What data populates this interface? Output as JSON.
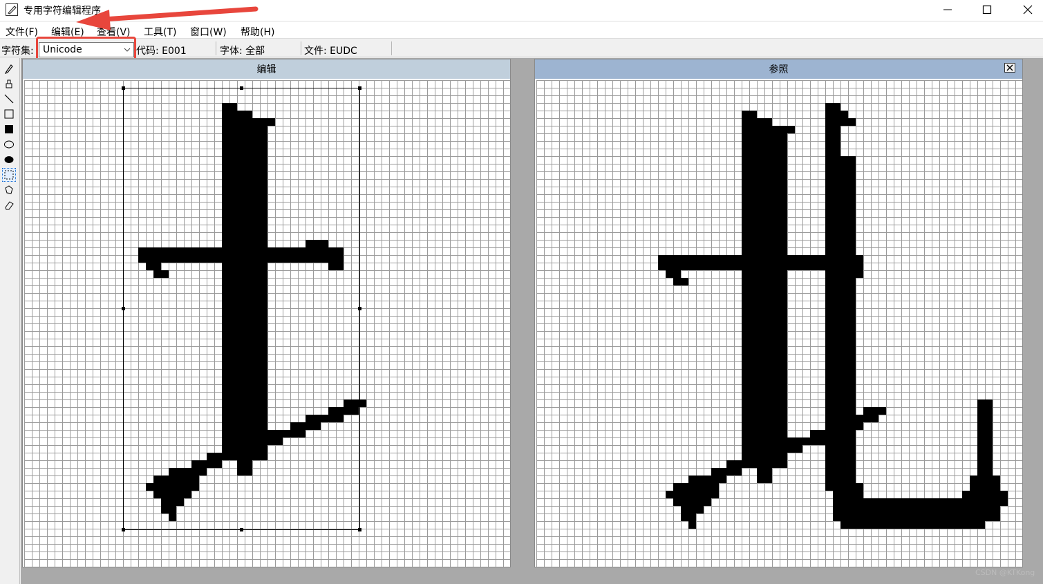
{
  "window": {
    "title": "专用字符编辑程序",
    "controls": {
      "minimize": "minimize-icon",
      "maximize": "maximize-icon",
      "close": "close-icon"
    }
  },
  "menu": [
    {
      "label": "文件(F)"
    },
    {
      "label": "编辑(E)"
    },
    {
      "label": "查看(V)"
    },
    {
      "label": "工具(T)"
    },
    {
      "label": "窗口(W)"
    },
    {
      "label": "帮助(H)"
    }
  ],
  "infobar": {
    "charset_label": "字符集:",
    "charset_value": "Unicode",
    "code_label": "代码: E001",
    "font_label": "字体: 全部",
    "file_label": "文件: EUDC"
  },
  "tools": [
    {
      "icon": "pencil-icon"
    },
    {
      "icon": "brush-icon"
    },
    {
      "icon": "line-icon"
    },
    {
      "icon": "hollow-rectangle-icon"
    },
    {
      "icon": "filled-rectangle-icon"
    },
    {
      "icon": "hollow-ellipse-icon"
    },
    {
      "icon": "filled-ellipse-icon"
    },
    {
      "icon": "rectangle-select-icon",
      "active": true
    },
    {
      "icon": "freeform-select-icon"
    },
    {
      "icon": "eraser-icon"
    }
  ],
  "panels": {
    "edit": {
      "title": "编辑"
    },
    "reference": {
      "title": "参照",
      "close_icon": "close-icon"
    }
  },
  "watermark": "CSDN @KTKong",
  "colors": {
    "highlight": "#e8463c",
    "edit_title_bg": "#c0cfdc",
    "reference_title_bg": "#9db4d1",
    "workspace_bg": "#a9a9a9"
  }
}
